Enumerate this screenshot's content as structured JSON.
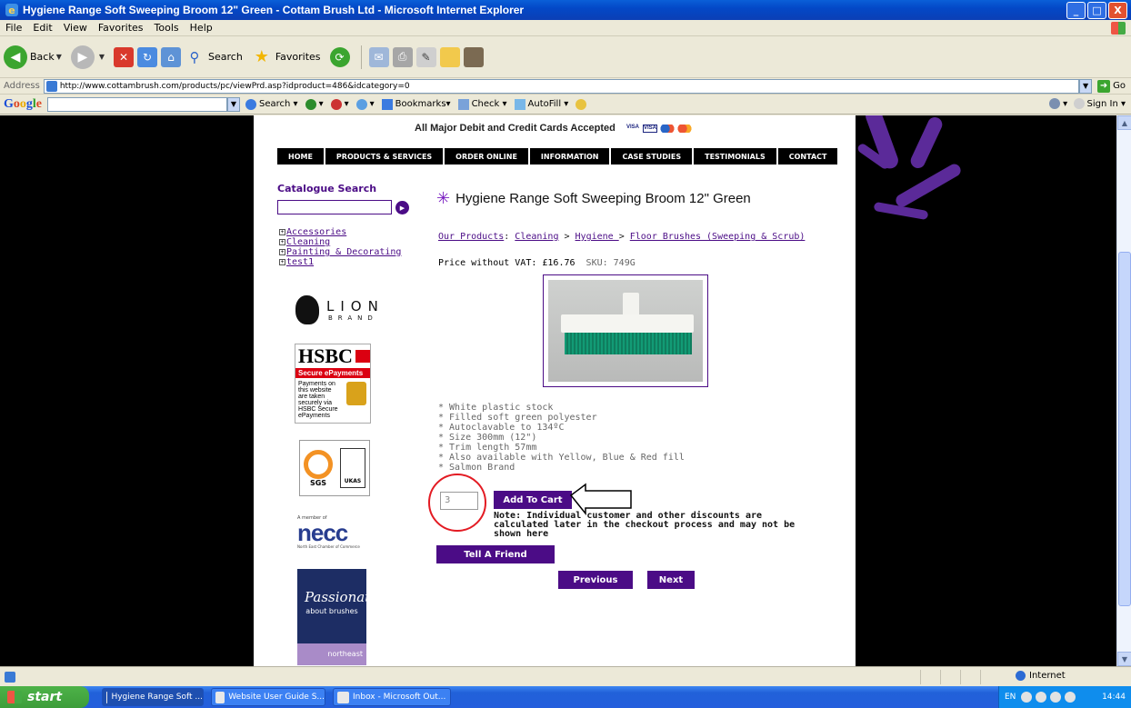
{
  "window": {
    "title": "Hygiene Range Soft Sweeping Broom 12\" Green - Cottam Brush Ltd - Microsoft Internet Explorer",
    "min": "_",
    "max": "□",
    "close": "X"
  },
  "menubar": [
    "File",
    "Edit",
    "View",
    "Favorites",
    "Tools",
    "Help"
  ],
  "toolbar": {
    "back": "Back",
    "search": "Search",
    "favorites": "Favorites"
  },
  "address": {
    "label": "Address",
    "url": "http://www.cottambrush.com/products/pc/viewPrd.asp?idproduct=486&idcategory=0",
    "go": "Go"
  },
  "google_bar": {
    "search": "Search",
    "bookmarks": "Bookmarks",
    "check": "Check",
    "autofill": "AutoFill",
    "sign_in": "Sign In"
  },
  "page": {
    "cards_text": "All Major Debit and Credit Cards Accepted",
    "nav": [
      "HOME",
      "PRODUCTS & SERVICES",
      "ORDER ONLINE",
      "INFORMATION",
      "CASE STUDIES",
      "TESTIMONIALS",
      "CONTACT"
    ],
    "catalogue": {
      "title": "Catalogue Search",
      "categories": [
        "Accessories",
        "Cleaning",
        "Painting & Decorating",
        "test1"
      ]
    },
    "logos": {
      "lion_big": "LION",
      "lion_small": "BRAND",
      "hsbc": "HSBC",
      "hsbc_strip": "Secure ePayments",
      "hsbc_body": "Payments on this website are taken securely via HSBC Secure ePayments",
      "sgs": "SGS",
      "ukas": "UKAS",
      "necc_small": "A member of",
      "necc": "necc",
      "necc_sub": "North East Chamber of Commerce",
      "passionate": "Passionate",
      "about": "about brushes",
      "northeast": "northeast"
    },
    "product": {
      "title": "Hygiene Range Soft Sweeping Broom 12\" Green",
      "breadcrumb": {
        "our_products": "Our Products",
        "sep1": ": ",
        "cleaning": "Cleaning",
        "sep2": " > ",
        "hygiene": "Hygiene ",
        "sep3": "> ",
        "floor": "Floor Brushes (Sweeping & Scrub)"
      },
      "price_label": "Price without VAT: £16.76",
      "sku": "SKU: 749G",
      "features": [
        "* White plastic stock",
        "* Filled soft green polyester",
        "* Autoclavable to 134ºC",
        "* Size 300mm (12\")",
        "* Trim length 57mm",
        "* Also available with Yellow, Blue & Red fill",
        "* Salmon Brand"
      ],
      "quantity": "3",
      "add_to_cart": "Add To Cart",
      "note": "Note: Individual customer and other discounts are calculated later in the checkout process and may not be shown here",
      "tell_friend": "Tell A Friend",
      "previous": "Previous",
      "next": "Next"
    }
  },
  "statusbar": {
    "zone": "Internet"
  },
  "taskbar": {
    "start": "start",
    "tasks": [
      "Hygiene Range Soft ...",
      "Website User Guide S...",
      "Inbox - Microsoft Out..."
    ],
    "lang": "EN",
    "time": "14:44"
  },
  "colors": {
    "brand_purple": "#4b0c86",
    "annotation_red": "#e31b23"
  }
}
